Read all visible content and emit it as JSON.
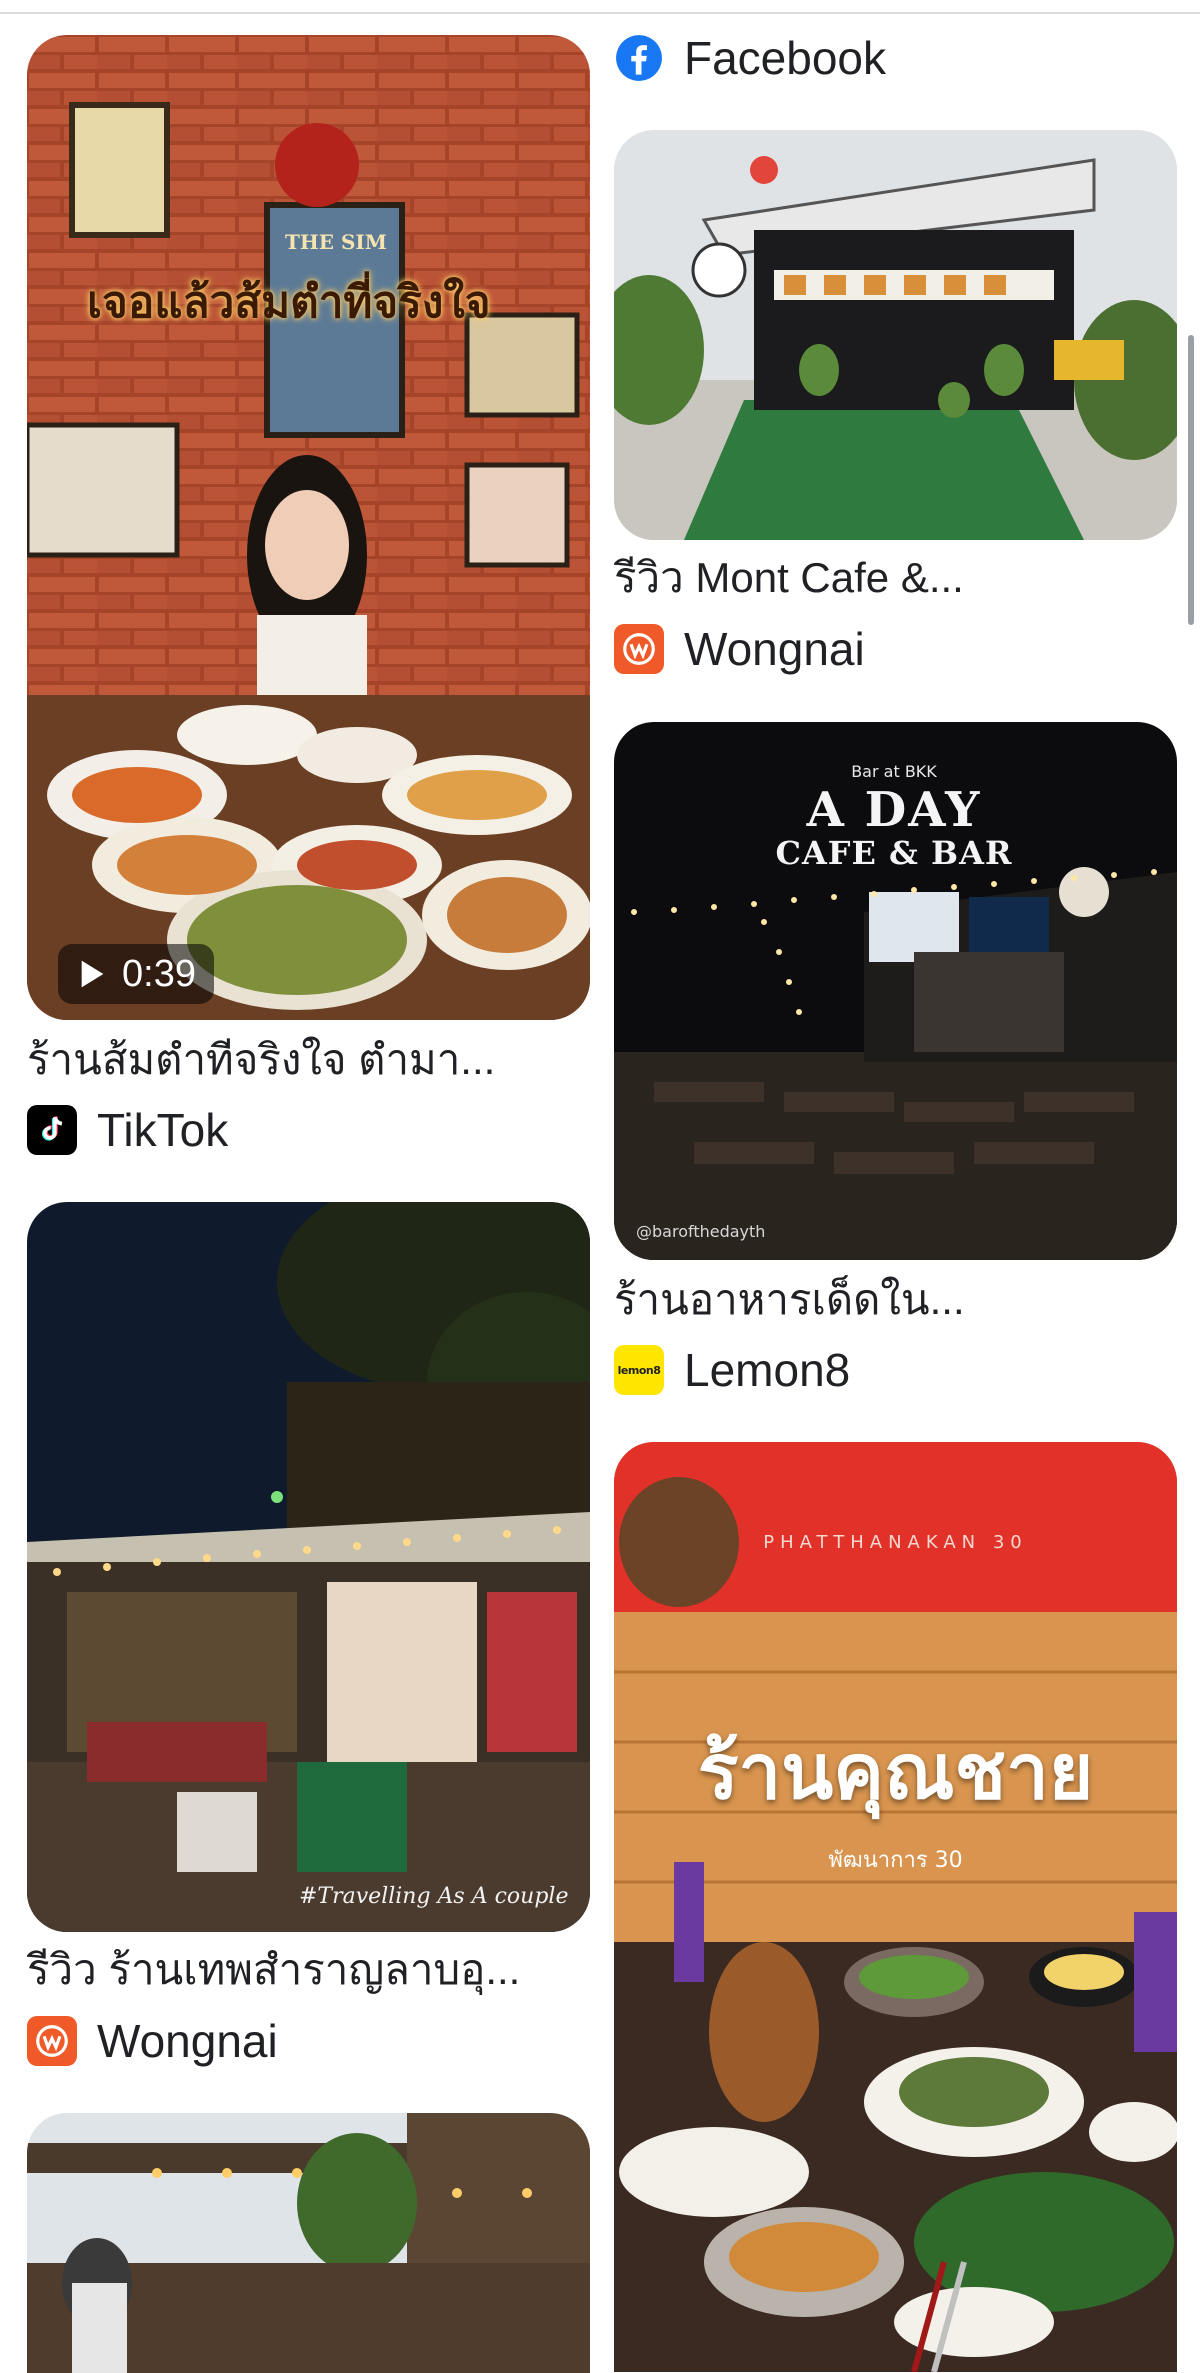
{
  "results": {
    "left": [
      {
        "title": "ร้านส้มตำทีจริงใจ ตำมา...",
        "source": "TikTok",
        "source_icon": "tiktok-icon",
        "video_duration": "0:39",
        "overlay_text": "เจอแล้วส้มตำที่จริงใจ",
        "sign_text": "THE SIM"
      },
      {
        "title": "รีวิว ร้านเทพสำราญลาบอุ...",
        "source": "Wongnai",
        "source_icon": "wongnai-icon",
        "watermark": "#Travelling As A couple"
      },
      {
        "title": "",
        "source": "",
        "source_icon": ""
      }
    ],
    "right": [
      {
        "source": "Facebook",
        "source_icon": "facebook-icon"
      },
      {
        "title": "รีวิว Mont Cafe &...",
        "source": "Wongnai",
        "source_icon": "wongnai-icon"
      },
      {
        "title": "ร้านอาหารเด็ดใน...",
        "source": "Lemon8",
        "source_icon": "lemon8-icon",
        "overlay_small": "Bar at BKK",
        "overlay_big1": "A DAY",
        "overlay_big2": "CAFE & BAR",
        "watermark": "@barofthedayth"
      },
      {
        "overlay_top": "PHATTHANAKAN 30",
        "overlay_big": "ร้านคุณชาย",
        "overlay_sub": "พัฒนาการ 30"
      }
    ]
  },
  "colors": {
    "wongnai": "#f05a28",
    "facebook": "#1877f2",
    "lemon8": "#ffe600",
    "tiktok": "#000000"
  }
}
